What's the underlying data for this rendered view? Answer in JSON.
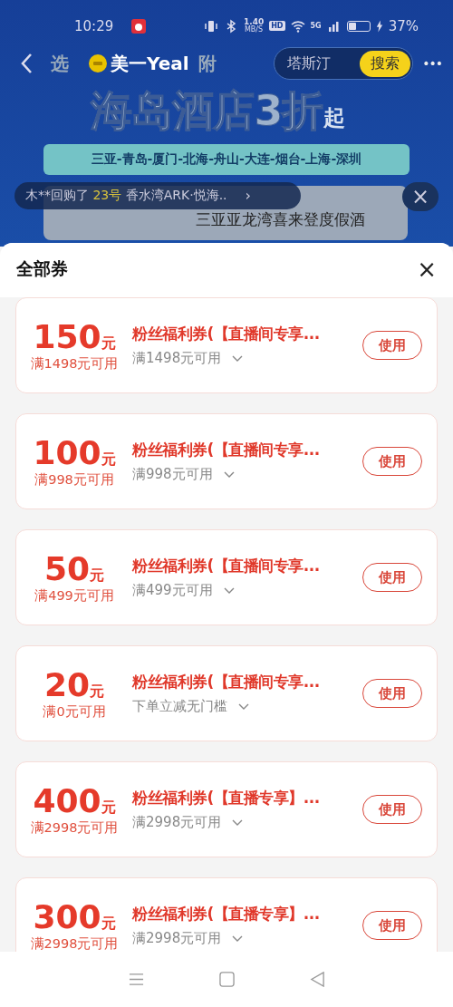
{
  "status_bar": {
    "time": "10:29",
    "speed": "1.40",
    "speed_unit": "MB/S",
    "hd": "HD",
    "network": "5G",
    "battery": "37%"
  },
  "nav": {
    "tab_left": "选",
    "brand": "美一Yeal",
    "tab_right": "附",
    "search": {
      "value": "塔斯汀",
      "button": "搜索"
    },
    "more": "•••"
  },
  "banner": {
    "title": "海岛酒店3折",
    "title_suffix": "起",
    "cities": "三亚-青岛-厦门-北海-舟山-大连-烟台-上海-深圳"
  },
  "ticker": {
    "buyer": "木**回购了",
    "highlight": "23号",
    "item": "香水湾ARK·悦海..",
    "arrow": "›",
    "close": "×"
  },
  "hotel_card": {
    "name": "三亚亚龙湾喜来登度假酒"
  },
  "sheet": {
    "title": "全部券",
    "close": "×",
    "coupons": [
      {
        "amount": "150",
        "unit": "元",
        "condition": "满1498元可用",
        "title": "粉丝福利券(【直播间专享...",
        "desc": "满1498元可用",
        "button": "使用"
      },
      {
        "amount": "100",
        "unit": "元",
        "condition": "满998元可用",
        "title": "粉丝福利券(【直播间专享...",
        "desc": "满998元可用",
        "button": "使用"
      },
      {
        "amount": "50",
        "unit": "元",
        "condition": "满499元可用",
        "title": "粉丝福利券(【直播间专享...",
        "desc": "满499元可用",
        "button": "使用"
      },
      {
        "amount": "20",
        "unit": "元",
        "condition": "满0元可用",
        "title": "粉丝福利券(【直播间专享...",
        "desc": "下单立减无门槛",
        "button": "使用"
      },
      {
        "amount": "400",
        "unit": "元",
        "condition": "满2998元可用",
        "title": "粉丝福利券(【直播专享】...",
        "desc": "满2998元可用",
        "button": "使用"
      },
      {
        "amount": "300",
        "unit": "元",
        "condition": "满2998元可用",
        "title": "粉丝福利券(【直播专享】...",
        "desc": "满2998元可用",
        "button": "使用"
      }
    ]
  }
}
